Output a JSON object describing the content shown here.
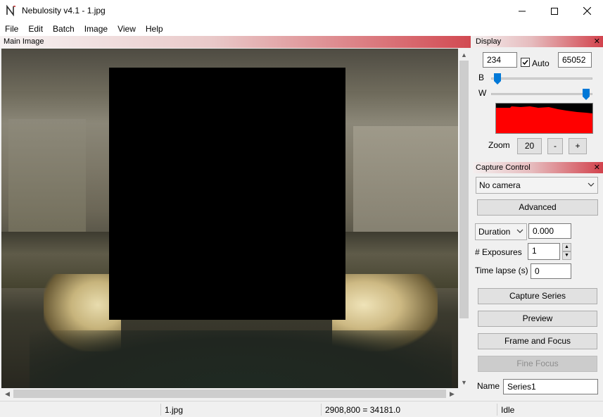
{
  "window": {
    "title": "Nebulosity v4.1 - 1.jpg"
  },
  "menubar": {
    "items": [
      "File",
      "Edit",
      "Batch",
      "Image",
      "View",
      "Help"
    ]
  },
  "main_panel": {
    "title": "Main Image"
  },
  "display": {
    "title": "Display",
    "black_value": "234",
    "auto_label": "Auto",
    "auto_checked": true,
    "white_value": "65052",
    "b_label": "B",
    "w_label": "W",
    "b_slider_level": 0.03,
    "w_slider_level": 0.97,
    "zoom_label": "Zoom",
    "zoom_value": "20",
    "zoom_minus": "-",
    "zoom_plus": "+",
    "histogram_color": "#ff0000"
  },
  "capture": {
    "title": "Capture Control",
    "camera_select": "No camera",
    "advanced_label": "Advanced",
    "duration_select": "Duration",
    "duration_value": "0.000",
    "exposures_label": "# Exposures",
    "exposures_value": "1",
    "timelapse_label": "Time lapse (s)",
    "timelapse_value": "0",
    "capture_series_label": "Capture Series",
    "preview_label": "Preview",
    "frame_focus_label": "Frame and Focus",
    "fine_focus_label": "Fine Focus",
    "name_label": "Name",
    "name_value": "Series1"
  },
  "statusbar": {
    "file": "1.jpg",
    "coords": "2908,800 = 34181.0",
    "status": "Idle"
  },
  "colors": {
    "panel_accent": "#d2424c",
    "slider_thumb": "#0078d7"
  }
}
